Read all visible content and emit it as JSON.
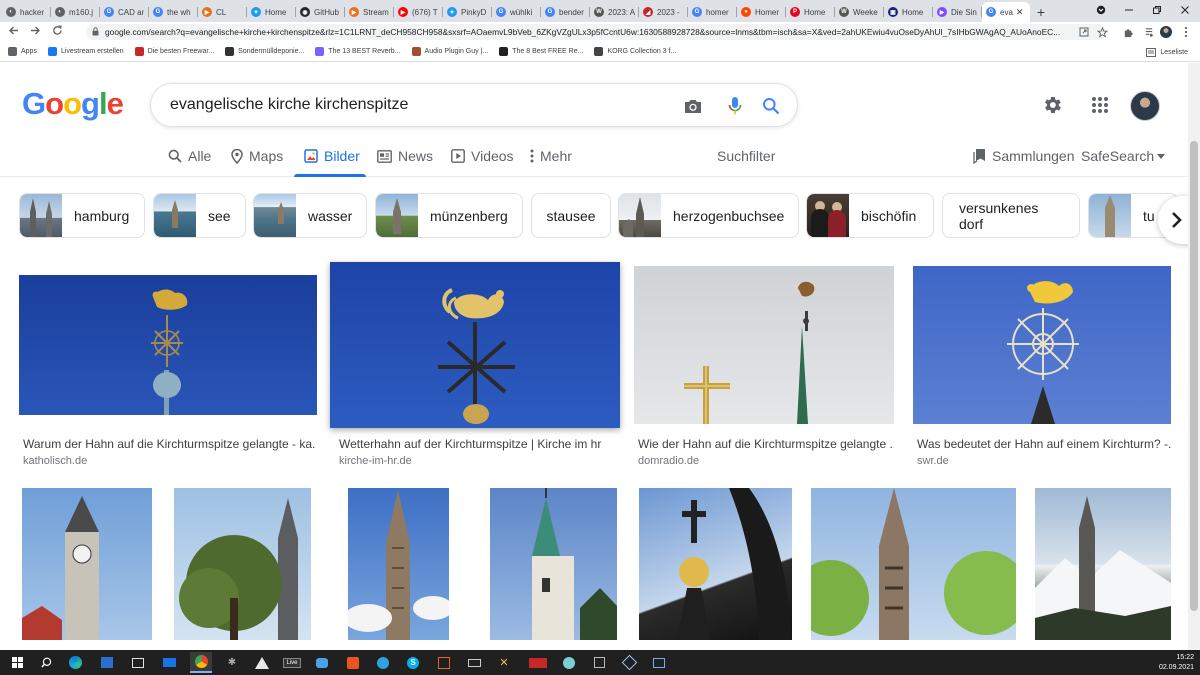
{
  "browser": {
    "tabs": [
      {
        "label": "hacker",
        "color": "#5f6368",
        "glyph": "◐"
      },
      {
        "label": "m160.j",
        "color": "#5f6368",
        "glyph": "◐"
      },
      {
        "label": "CAD ar",
        "color": "#4285f4",
        "glyph": "G"
      },
      {
        "label": "the wh",
        "color": "#4285f4",
        "glyph": "G"
      },
      {
        "label": "CL",
        "color": "#e8711a",
        "glyph": "▶"
      },
      {
        "label": "Home",
        "color": "#1d9bf0",
        "glyph": "✦"
      },
      {
        "label": "GitHub",
        "color": "#24292f",
        "glyph": "◉"
      },
      {
        "label": "Stream",
        "color": "#e8711a",
        "glyph": "▶"
      },
      {
        "label": "(676) T",
        "color": "#ff0000",
        "glyph": "▶"
      },
      {
        "label": "PinkyD",
        "color": "#1d9bf0",
        "glyph": "✦"
      },
      {
        "label": "wühlki",
        "color": "#4285f4",
        "glyph": "G"
      },
      {
        "label": "bender",
        "color": "#4285f4",
        "glyph": "G"
      },
      {
        "label": "2023: A",
        "color": "#555555",
        "glyph": "W"
      },
      {
        "label": "2023 -",
        "color": "#c62828",
        "glyph": "◢"
      },
      {
        "label": "homer",
        "color": "#4285f4",
        "glyph": "G"
      },
      {
        "label": "Homer",
        "color": "#ff4500",
        "glyph": "●"
      },
      {
        "label": "Home",
        "color": "#e60023",
        "glyph": "P"
      },
      {
        "label": "Weeke",
        "color": "#555555",
        "glyph": "W"
      },
      {
        "label": "Home",
        "color": "#1a237e",
        "glyph": "▣"
      },
      {
        "label": "Die Sin",
        "color": "#7c4dff",
        "glyph": "▶"
      },
      {
        "label": "eva",
        "color": "#4285f4",
        "glyph": "G"
      }
    ],
    "active_tab_close": "✕",
    "new_tab": "+",
    "address": "google.com/search?q=evangelische+kirche+kirchenspitze&rlz=1C1LRNT_deCH958CH958&sxsrf=AOaemvL9bVeb_6ZKgVZgULx3p5fCcntU6w:1630588928728&source=lnms&tbm=isch&sa=X&ved=2ahUKEwiu4vuOseDyAhUI_7sIHbGWAgAQ_AUoAnoEC...",
    "bookmarks": [
      {
        "label": "Apps",
        "color": "#5f6368"
      },
      {
        "label": "Livestream erstellen",
        "color": "#1877f2"
      },
      {
        "label": "Die besten Freewar...",
        "color": "#c62828"
      },
      {
        "label": "Sondermülldeponie...",
        "color": "#333333"
      },
      {
        "label": "The 13 BEST Reverb...",
        "color": "#7b61ff"
      },
      {
        "label": "Audio Plugin Guy |...",
        "color": "#a0522d"
      },
      {
        "label": "The 8 Best FREE Re...",
        "color": "#222222"
      },
      {
        "label": "KORG Collection 3 f...",
        "color": "#444444"
      }
    ],
    "reading_list": "Leseliste"
  },
  "search": {
    "query": "evangelische kirche kirchenspitze",
    "logo_letters": [
      {
        "ch": "G",
        "color": "#4285f4"
      },
      {
        "ch": "o",
        "color": "#ea4335"
      },
      {
        "ch": "o",
        "color": "#fbbc05"
      },
      {
        "ch": "g",
        "color": "#4285f4"
      },
      {
        "ch": "l",
        "color": "#34a853"
      },
      {
        "ch": "e",
        "color": "#ea4335"
      }
    ]
  },
  "nav": {
    "items": [
      {
        "label": "Alle",
        "icon": "search-icon"
      },
      {
        "label": "Maps",
        "icon": "map-pin-icon"
      },
      {
        "label": "Bilder",
        "icon": "image-icon"
      },
      {
        "label": "News",
        "icon": "news-icon"
      },
      {
        "label": "Videos",
        "icon": "video-icon"
      },
      {
        "label": "Mehr",
        "icon": "more-vert-icon"
      }
    ],
    "active": "Bilder",
    "filter": "Suchfilter",
    "collections": "Sammlungen",
    "safesearch": "SafeSearch"
  },
  "chips": [
    {
      "label": "hamburg"
    },
    {
      "label": "see"
    },
    {
      "label": "wasser"
    },
    {
      "label": "münzenberg"
    },
    {
      "label": "stausee"
    },
    {
      "label": "herzogenbuchsee"
    },
    {
      "label": "bischöfin"
    },
    {
      "label": "versunkenes dorf"
    },
    {
      "label": "tu"
    }
  ],
  "results": [
    {
      "title": "Warum der Hahn auf die Kirchturmspitze gelangte - ka...",
      "source": "katholisch.de"
    },
    {
      "title": "Wetterhahn auf der Kirchturmspitze | Kirche im hr",
      "source": "kirche-im-hr.de"
    },
    {
      "title": "Wie der Hahn auf die Kirchturmspitze gelangte ...",
      "source": "domradio.de"
    },
    {
      "title": "Was bedeutet der Hahn auf einem Kirchturm? -...",
      "source": "swr.de"
    }
  ],
  "taskbar": {
    "time": "15:22",
    "date": "02.09.2021"
  }
}
